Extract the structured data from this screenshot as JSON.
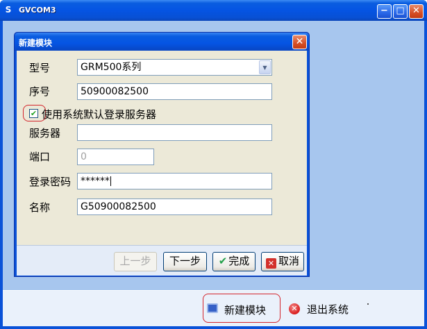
{
  "window": {
    "title": "GVCOM3",
    "app_icon": "S",
    "minimize_glyph": "−",
    "maximize_glyph": "□",
    "close_glyph": "✕"
  },
  "bottom_bar": {
    "new_module_label": "新建模块",
    "exit_label": "退出系统",
    "exit_glyph": "✕",
    "new_module_icon": "monitor-icon",
    "exit_icon": "close-circle-icon"
  },
  "dialog": {
    "title": "新建模块",
    "close_glyph": "✕",
    "fields": {
      "model_label": "型号",
      "model_value": "GRM500系列",
      "serial_label": "序号",
      "serial_value": "50900082500",
      "default_server_checkbox_label": "使用系统默认登录服务器",
      "default_server_checked": true,
      "checkbox_glyph": "✔",
      "server_label": "服务器",
      "server_value": "",
      "port_label": "端口",
      "port_value": "0",
      "password_label": "登录密码",
      "password_value": "******",
      "name_label": "名称",
      "name_value": "G50900082500"
    },
    "buttons": {
      "prev_label": "上一步",
      "next_label": "下一步",
      "finish_label": "完成",
      "finish_glyph": "✔",
      "cancel_label": "取消",
      "cancel_glyph": "✕"
    }
  }
}
